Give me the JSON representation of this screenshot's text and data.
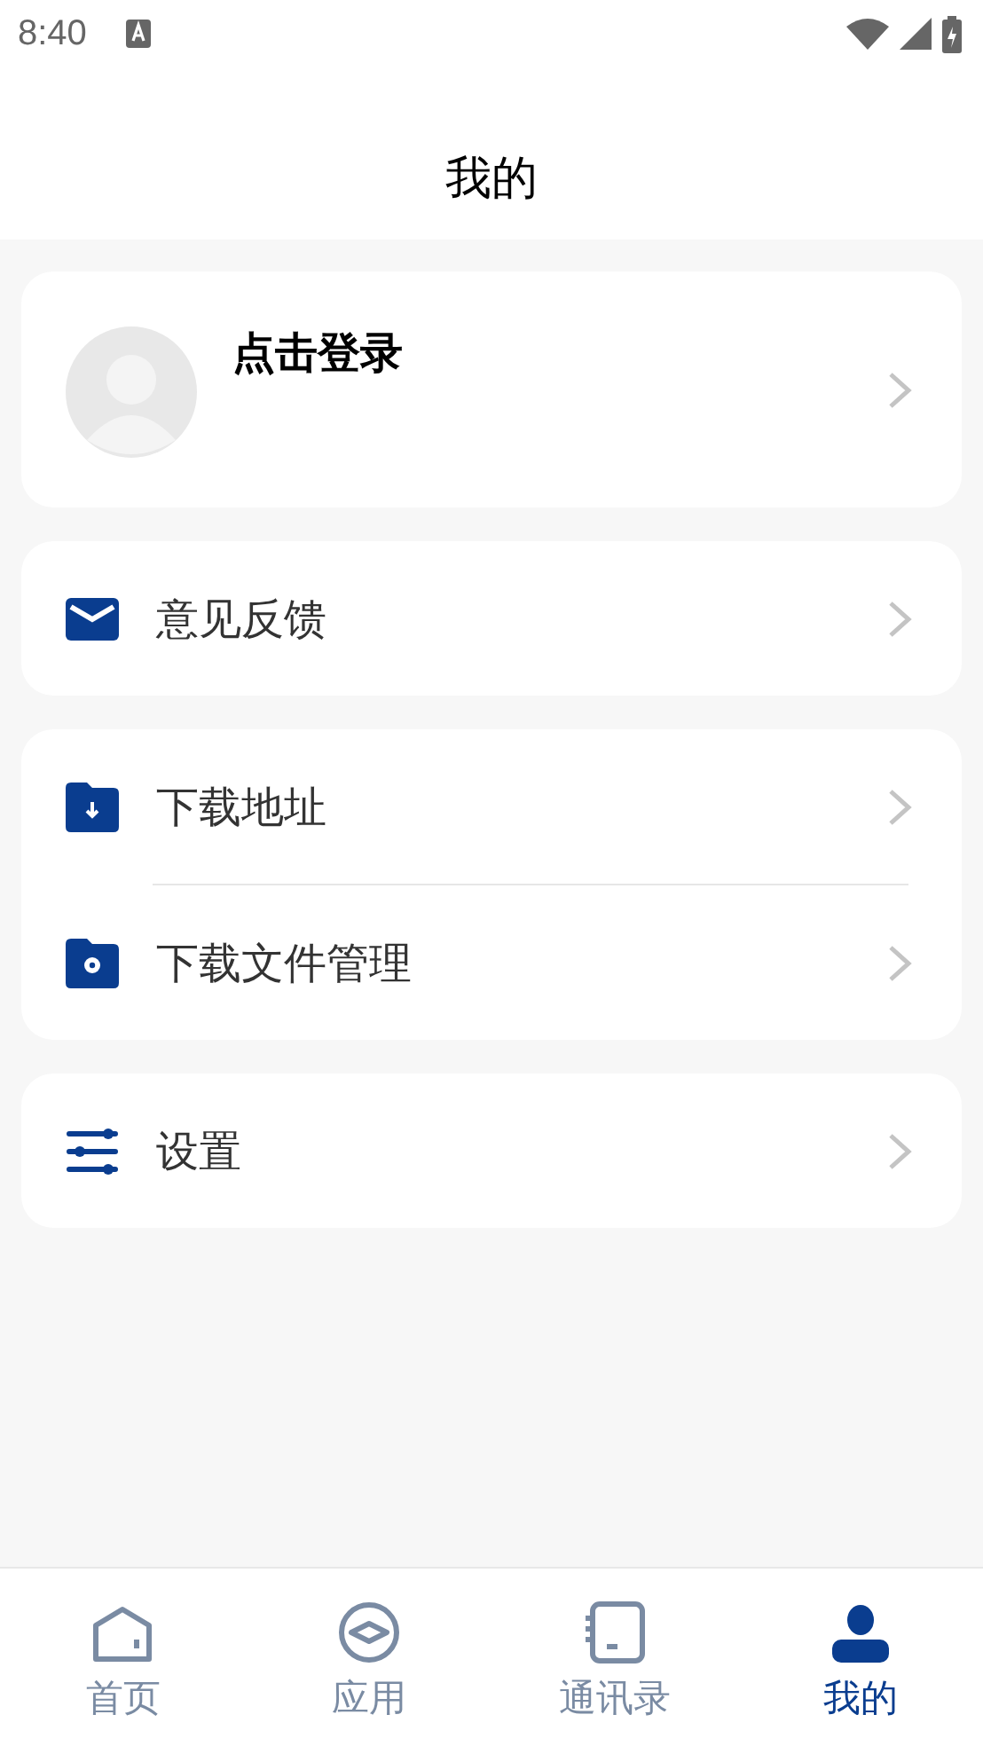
{
  "status_bar": {
    "time": "8:40"
  },
  "header": {
    "title": "我的"
  },
  "profile": {
    "login_label": "点击登录"
  },
  "menu_groups": [
    {
      "items": [
        {
          "kind": "mail",
          "label": "意见反馈"
        }
      ]
    },
    {
      "items": [
        {
          "kind": "folder-download",
          "label": "下载地址"
        },
        {
          "kind": "folder-gear",
          "label": "下载文件管理"
        }
      ]
    },
    {
      "items": [
        {
          "kind": "sliders",
          "label": "设置"
        }
      ]
    }
  ],
  "bottom_nav": [
    {
      "kind": "home",
      "label": "首页",
      "selected": false
    },
    {
      "kind": "apps",
      "label": "应用",
      "selected": false
    },
    {
      "kind": "contacts",
      "label": "通讯录",
      "selected": false
    },
    {
      "kind": "me",
      "label": "我的",
      "selected": true
    }
  ]
}
